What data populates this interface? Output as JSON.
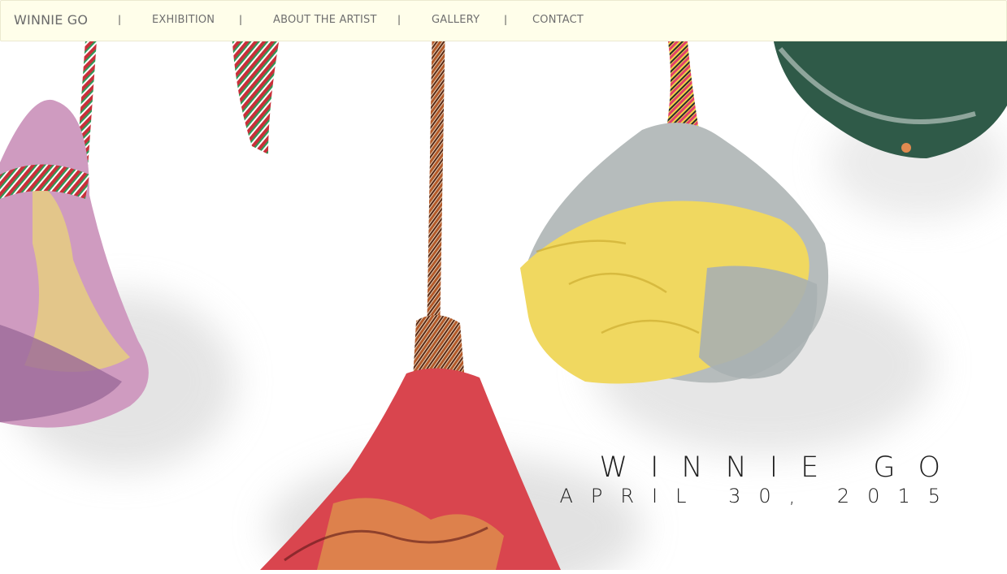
{
  "nav": {
    "brand": "WINNIE GO",
    "separator": "|",
    "links": [
      "EXHIBITION",
      "ABOUT THE ARTIST",
      "GALLERY",
      "CONTACT"
    ]
  },
  "hero": {
    "title": "WINNIE GO",
    "date": "APRIL 30, 2015",
    "image_alt_icons": [
      "pink-ceramic-tassel",
      "rope-tie",
      "red-ceramic-tassel",
      "yellow-ceramic-tassel",
      "green-ceramic-tassel"
    ]
  },
  "colors": {
    "nav_bg": "#fffeea",
    "nav_text": "#6f6f6f",
    "title_text": "#1e1e1e"
  }
}
